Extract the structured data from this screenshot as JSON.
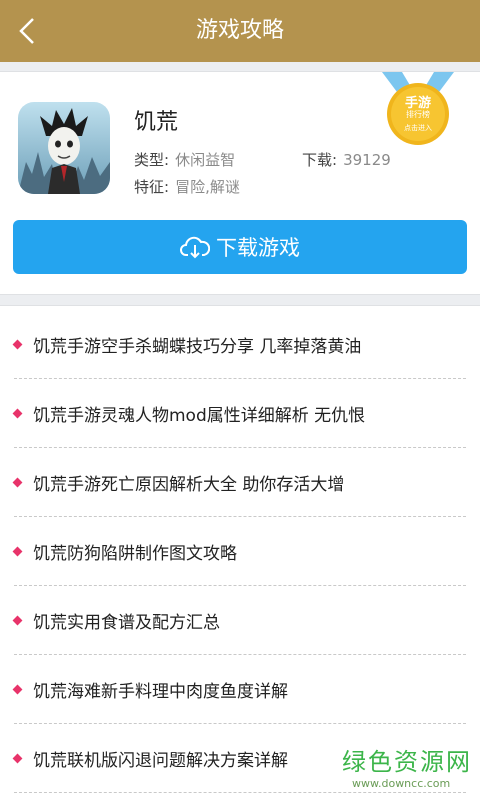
{
  "header": {
    "title": "游戏攻略"
  },
  "game": {
    "name": "饥荒",
    "type_label": "类型:",
    "type_value": "休闲益智",
    "downloads_label": "下载:",
    "downloads_value": "39129",
    "feature_label": "特征:",
    "feature_value": "冒险,解谜",
    "download_button": "下载游戏"
  },
  "badge": {
    "line1": "手游",
    "line2": "排行榜",
    "line3": "点击进入"
  },
  "articles": [
    "饥荒手游空手杀蝴蝶技巧分享 几率掉落黄油",
    "饥荒手游灵魂人物mod属性详细解析 无仇恨",
    "饥荒手游死亡原因解析大全 助你存活大增",
    "饥荒防狗陷阱制作图文攻略",
    "饥荒实用食谱及配方汇总",
    "饥荒海难新手料理中肉度鱼度详解",
    "饥荒联机版闪退问题解决方案详解"
  ],
  "watermark": {
    "name": "绿色资源网",
    "url": "www.downcc.com"
  },
  "colors": {
    "header": "#b4934e",
    "button": "#24a4ef",
    "bullet": "#e8336a",
    "badge": "#f3b820"
  },
  "icons": [
    "back-arrow-icon",
    "cloud-download-icon",
    "rank-medal-icon",
    "game-app-icon"
  ]
}
